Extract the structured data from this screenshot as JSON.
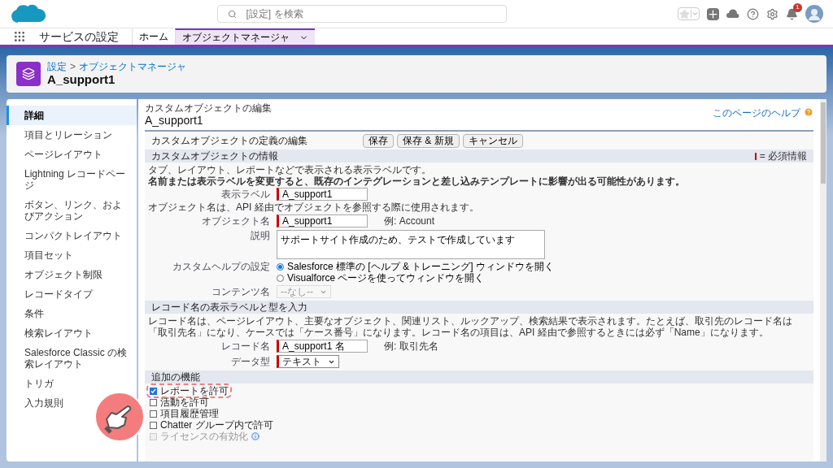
{
  "header": {
    "search_placeholder": "[設定] を検索",
    "notification_count": "1"
  },
  "nav": {
    "app_name": "サービスの設定",
    "tabs": [
      {
        "label": "ホーム",
        "selected": false,
        "menu": false
      },
      {
        "label": "オブジェクトマネージャ",
        "selected": true,
        "menu": true
      }
    ]
  },
  "page_header": {
    "breadcrumb": [
      "設定",
      "オブジェクトマネージャ"
    ],
    "breadcrumb_separator": ">",
    "title": "A_support1"
  },
  "sidebar": {
    "items": [
      {
        "label": "詳細",
        "selected": true
      },
      {
        "label": "項目とリレーション",
        "selected": false
      },
      {
        "label": "ページレイアウト",
        "selected": false
      },
      {
        "label": "Lightning レコードページ",
        "selected": false
      },
      {
        "label": "ボタン、リンク、およびアクション",
        "selected": false
      },
      {
        "label": "コンパクトレイアウト",
        "selected": false
      },
      {
        "label": "項目セット",
        "selected": false
      },
      {
        "label": "オブジェクト制限",
        "selected": false
      },
      {
        "label": "レコードタイプ",
        "selected": false
      },
      {
        "label": "条件",
        "selected": false
      },
      {
        "label": "検索レイアウト",
        "selected": false
      },
      {
        "label": "Salesforce Classic の検索レイアウト",
        "selected": false
      },
      {
        "label": "トリガ",
        "selected": false
      },
      {
        "label": "入力規則",
        "selected": false
      }
    ]
  },
  "main": {
    "subtitle": "カスタムオブジェクトの編集",
    "title": "A_support1",
    "help_link": "このページのヘルプ",
    "edit_block": {
      "title": "カスタムオブジェクトの定義の編集",
      "buttons": [
        "保存",
        "保存 & 新規",
        "キャンセル"
      ]
    },
    "sections": [
      {
        "title": "カスタムオブジェクトの情報",
        "legend": "= 必須情報",
        "rows": [
          {
            "kind": "note",
            "text": "タブ、レイアウト、レポートなどで表示される表示ラベルです。",
            "bold": false
          },
          {
            "kind": "note",
            "text": "名前または表示ラベルを変更すると、既存のインテグレーションと差し込みテンプレートに影響が出る可能性があります。",
            "bold": true
          },
          {
            "kind": "text",
            "label": "表示ラベル",
            "value": "A_support1",
            "required": true
          },
          {
            "kind": "note",
            "text": "オブジェクト名は、API 経由でオブジェクトを参照する際に使用されます。",
            "bold": false
          },
          {
            "kind": "text",
            "label": "オブジェクト名",
            "value": "A_support1",
            "required": true,
            "example": "例:  Account"
          },
          {
            "kind": "textarea",
            "label": "説明",
            "value": "サポートサイト作成のため、テストで作成しています"
          },
          {
            "kind": "radio",
            "label": "カスタムヘルプの設定",
            "options": [
              {
                "label": "Salesforce 標準の [ヘルプ & トレーニング] ウィンドウを開く",
                "selected": true
              },
              {
                "label": "Visualforce ページを使ってウィンドウを開く",
                "selected": false
              }
            ]
          },
          {
            "kind": "select",
            "label": "コンテンツ名",
            "value": "--なし--",
            "required": false,
            "disabled": true
          }
        ]
      },
      {
        "title": "レコード名の表示ラベルと型を入力",
        "rows": [
          {
            "kind": "note",
            "text": "レコード名は、ページレイアウト、主要なオブジェクト、関連リスト、ルックアップ、検索結果で表示されます。たとえば、取引先のレコード名は「取引先名」になり、ケースでは「ケース番号」になります。レコード名の項目は、API 経由で参照するときには必ず「Name」になります。",
            "bold": false
          },
          {
            "kind": "text",
            "label": "レコード名",
            "value": "A_support1 名",
            "required": true,
            "example": "例:  取引先名"
          },
          {
            "kind": "select",
            "label": "データ型",
            "value": "テキスト",
            "required": true,
            "disabled": false
          }
        ]
      },
      {
        "title": "追加の機能",
        "rows": [
          {
            "kind": "checkbox",
            "label": "レポートを許可",
            "checked": true,
            "disabled": false,
            "highlighted": true
          },
          {
            "kind": "checkbox",
            "label": "活動を許可",
            "checked": false,
            "disabled": false,
            "highlighted": false
          },
          {
            "kind": "checkbox",
            "label": "項目履歴管理",
            "checked": false,
            "disabled": false,
            "highlighted": false
          },
          {
            "kind": "checkbox",
            "label": "Chatter グループ内で許可",
            "checked": false,
            "disabled": false,
            "highlighted": false
          },
          {
            "kind": "checkbox",
            "label": "ライセンスの有効化",
            "checked": false,
            "disabled": true,
            "highlighted": false,
            "info": true
          }
        ]
      }
    ]
  }
}
